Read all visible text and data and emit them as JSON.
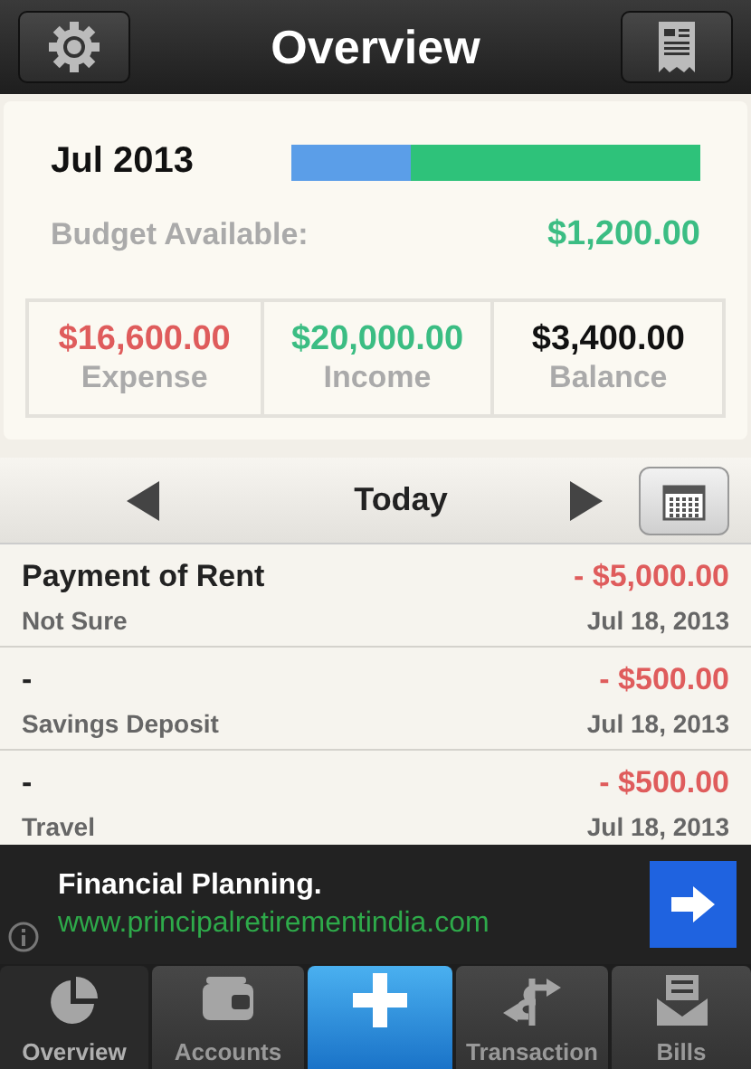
{
  "header": {
    "title": "Overview"
  },
  "summary": {
    "month": "Jul 2013",
    "budget_bar": {
      "level": 0.29
    },
    "budget_label": "Budget Available:",
    "budget_value": "$1,200.00",
    "totals": [
      {
        "kind": "expense",
        "value": "$16,600.00",
        "label": "Expense"
      },
      {
        "kind": "income",
        "value": "$20,000.00",
        "label": "Income"
      },
      {
        "kind": "balance",
        "value": "$3,400.00",
        "label": "Balance"
      }
    ]
  },
  "date_nav": {
    "label": "Today"
  },
  "transactions": [
    {
      "title": "Payment of Rent",
      "amount": "- $5,000.00",
      "category": "Not Sure",
      "date": "Jul 18, 2013"
    },
    {
      "title": "-",
      "amount": "- $500.00",
      "category": "Savings Deposit",
      "date": "Jul 18, 2013"
    },
    {
      "title": "-",
      "amount": "- $500.00",
      "category": "Travel",
      "date": "Jul 18, 2013"
    }
  ],
  "ad": {
    "title": "Financial Planning.",
    "url": "www.principalretirementindia.com"
  },
  "tabs": [
    {
      "kind": "overview",
      "label": "Overview",
      "selected": true
    },
    {
      "kind": "accounts",
      "label": "Accounts",
      "selected": false
    },
    {
      "kind": "add"
    },
    {
      "kind": "transaction",
      "label": "Transaction",
      "selected": false
    },
    {
      "kind": "bills",
      "label": "Bills",
      "selected": false
    }
  ]
}
